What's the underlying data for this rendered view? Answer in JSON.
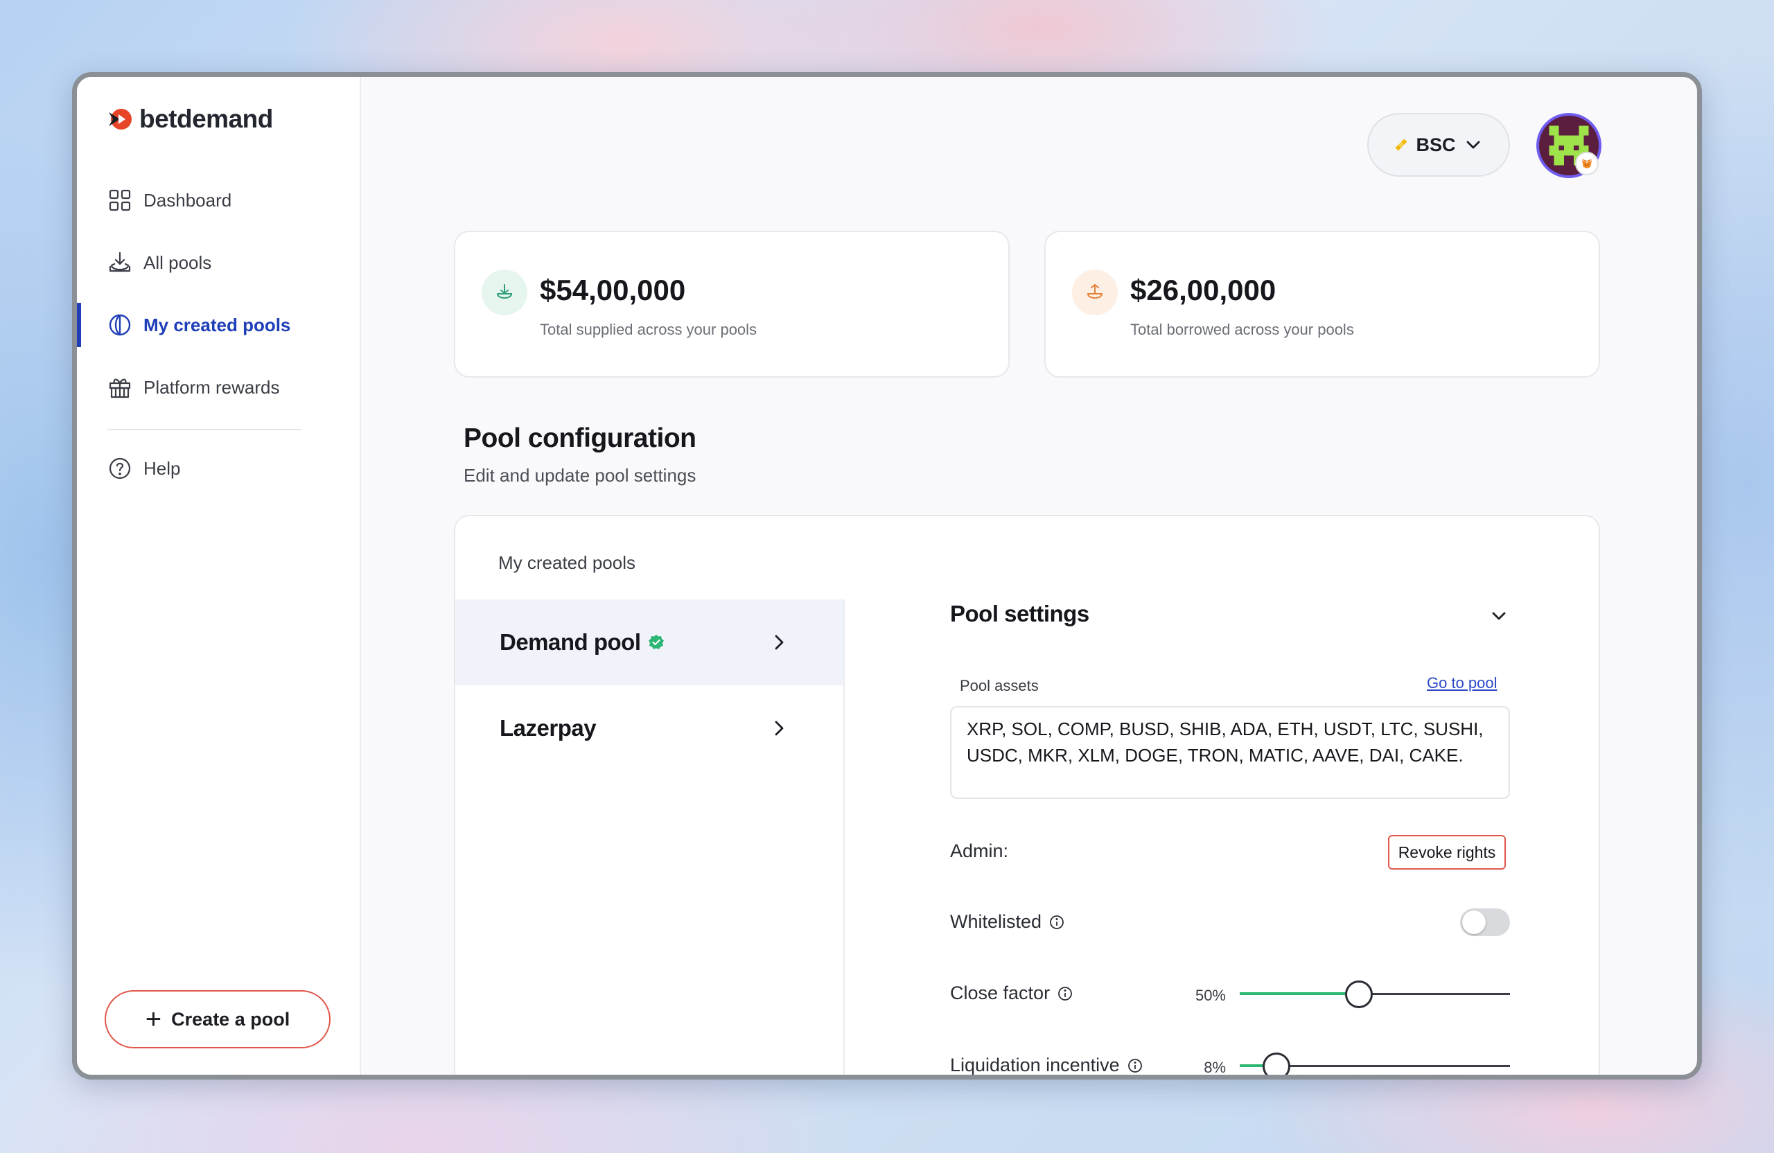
{
  "brand": {
    "name": "betdemand"
  },
  "sidebar": {
    "items": [
      {
        "label": "Dashboard",
        "icon": "grid-icon"
      },
      {
        "label": "All pools",
        "icon": "download-tray-icon"
      },
      {
        "label": "My created pools",
        "icon": "half-circle-icon",
        "active": true
      },
      {
        "label": "Platform rewards",
        "icon": "gift-icon"
      },
      {
        "label": "Help",
        "icon": "help-icon"
      }
    ],
    "create_button": "Create a pool"
  },
  "header": {
    "network": "BSC",
    "network_color": "#f0b90b",
    "avatar_badge": "metamask-fox-icon"
  },
  "stats": [
    {
      "value": "$54,00,000",
      "label": "Total supplied across your pools",
      "accent": "#2f9e78"
    },
    {
      "value": "$26,00,000",
      "label": "Total borrowed across your pools",
      "accent": "#e2823a"
    }
  ],
  "section": {
    "title": "Pool configuration",
    "subtitle": "Edit and update pool settings"
  },
  "panel": {
    "heading": "My created pools",
    "pools": [
      {
        "name": "Demand pool",
        "verified": true,
        "selected": true
      },
      {
        "name": "Lazerpay",
        "verified": false,
        "selected": false
      }
    ],
    "settings": {
      "title": "Pool settings",
      "assets_label": "Pool assets",
      "go_to_pool": "Go to pool",
      "assets": "XRP, SOL, COMP, BUSD, SHIB, ADA, ETH, USDT, LTC, SUSHI, USDC, MKR, XLM, DOGE, TRON, MATIC, AAVE, DAI, CAKE.",
      "admin_label": "Admin:",
      "revoke_label": "Revoke rights",
      "whitelisted_label": "Whitelisted",
      "whitelisted_on": false,
      "close_factor_label": "Close factor",
      "close_factor_value": "50%",
      "close_factor_fraction": 0.44,
      "liquidation_label": "Liquidation incentive",
      "liquidation_value": "8%",
      "liquidation_fraction": 0.135
    }
  }
}
